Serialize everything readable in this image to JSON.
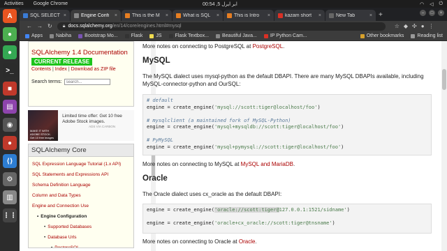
{
  "system": {
    "activities": "Activities",
    "app": "Google Chrome",
    "clock": "00:54 ,5 ابر ایرل",
    "tray": [
      "wifi-icon",
      "volume-icon",
      "power-icon"
    ]
  },
  "dock": {
    "apps": [
      {
        "name": "ubuntu-software-icon",
        "color": "#e95420",
        "glyph": "A"
      },
      {
        "name": "chrome-icon",
        "color": "#4caf50",
        "glyph": "●"
      },
      {
        "name": "chrome-alt-icon",
        "color": "#34a853",
        "glyph": "●"
      },
      {
        "name": "terminal-icon",
        "color": "#2b2b2b",
        "glyph": ">_"
      },
      {
        "name": "screen-recorder-icon",
        "color": "#c0392b",
        "glyph": "■"
      },
      {
        "name": "files-icon",
        "color": "#8e44ad",
        "glyph": "▤"
      },
      {
        "name": "camera-icon",
        "color": "#555",
        "glyph": "◉"
      },
      {
        "name": "recorder-icon",
        "color": "#c0392b",
        "glyph": "●"
      },
      {
        "name": "vscode-icon",
        "color": "#2d7dd2",
        "glyph": "⟨⟩"
      },
      {
        "name": "settings-icon",
        "color": "#666",
        "glyph": "⚙"
      },
      {
        "name": "trash-icon",
        "color": "#888",
        "glyph": "▥"
      },
      {
        "name": "apps-grid-icon",
        "color": "#444",
        "glyph": "⋮⋮"
      }
    ]
  },
  "tabs": [
    {
      "title": "SQL SELECT",
      "color": "#3a7bd5",
      "active": false
    },
    {
      "title": "Engine Confi",
      "color": "#888",
      "active": true
    },
    {
      "title": "This is the M",
      "color": "#e67e22",
      "active": false
    },
    {
      "title": "What is SQL",
      "color": "#e67e22",
      "active": false
    },
    {
      "title": "This is Intro",
      "color": "#e67e22",
      "active": false
    },
    {
      "title": "kazam short",
      "color": "#d93025",
      "active": false
    },
    {
      "title": "New Tab",
      "color": "#666",
      "active": false
    }
  ],
  "address": {
    "host": "docs.sqlalchemy.org",
    "path": "/en/14/core/engines.html#mysql"
  },
  "bookmarks": {
    "items": [
      {
        "label": "Apps",
        "color": "#4285f4"
      },
      {
        "label": "Nabiha",
        "color": "#888"
      },
      {
        "label": "Bootstrap Mo...",
        "color": "#7952b3"
      },
      {
        "label": "Flask",
        "color": "#333"
      },
      {
        "label": "JS",
        "color": "#f0db4f"
      },
      {
        "label": "Flask Textbox...",
        "color": "#333"
      },
      {
        "label": "Beautiful Java...",
        "color": "#888"
      },
      {
        "label": "IP Python Cam...",
        "color": "#d93025"
      }
    ],
    "other": "Other bookmarks",
    "reading": "Reading list"
  },
  "sidebar": {
    "title": "SQLAlchemy 1.4 Documentation",
    "release": "CURRENT RELEASE",
    "links": [
      "Contents",
      "Index",
      "Download as ZIP file"
    ],
    "search_label": "Search terms:",
    "search_placeholder": "search...",
    "ad_text": "Limited time offer: Get 10 free Adobe Stock images.",
    "ad_img_text": "MAKE IT WITH ADOBE STOCK.",
    "ad_img_cta": "Get 10 free images",
    "ad_small": "ADS VIA CARBON",
    "toc_title": "SQLAlchemy Core",
    "toc": [
      {
        "label": "SQL Expression Language Tutorial (1.x API)",
        "level": 1
      },
      {
        "label": "SQL Statements and Expressions API",
        "level": 1
      },
      {
        "label": "Schema Definition Language",
        "level": 1
      },
      {
        "label": "Column and Data Types",
        "level": 1
      },
      {
        "label": "Engine and Connection Use",
        "level": 1
      },
      {
        "label": "Engine Configuration",
        "level": 2
      },
      {
        "label": "Supported Databases",
        "level": 3
      },
      {
        "label": "Database Urls",
        "level": 3
      },
      {
        "label": "PostgreSQL",
        "level": 4
      }
    ]
  },
  "main": {
    "pg_note_prefix": "More notes on connecting to PostgreSQL at ",
    "pg_note_link": "PostgreSQL",
    "mysql_heading": "MySQL",
    "mysql_para": "The MySQL dialect uses mysql-python as the default DBAPI. There are many MySQL DBAPIs available, including MySQL-connector-python and OurSQL:",
    "mysql_code": [
      {
        "type": "cmt",
        "text": "# default"
      },
      {
        "type": "code",
        "pre": "engine = create_engine(",
        "str": "'mysql://scott:tiger@localhost/foo'",
        "post": ")"
      },
      {
        "type": "blank",
        "text": ""
      },
      {
        "type": "cmt",
        "text": "# mysqlclient (a maintained fork of MySQL-Python)"
      },
      {
        "type": "code",
        "pre": "engine = create_engine(",
        "str": "'mysql+mysqldb://scott:tiger@localhost/foo'",
        "post": ")"
      },
      {
        "type": "blank",
        "text": ""
      },
      {
        "type": "cmt",
        "text": "# PyMySQL"
      },
      {
        "type": "code",
        "pre": "engine = create_engine(",
        "str": "'mysql+pymysql://scott:tiger@localhost/foo'",
        "post": ")"
      }
    ],
    "mysql_note_prefix": "More notes on connecting to MySQL at ",
    "mysql_note_link": "MySQL and MariaDB",
    "oracle_heading": "Oracle",
    "oracle_para": "The Oracle dialect uses cx_oracle as the default DBAPI:",
    "oracle_code_1_pre": "engine = create_engine(",
    "oracle_code_1_str_a": "'oracle://scott:tiger@",
    "oracle_code_1_str_b": "127.0.0.1:1521/sidname'",
    "oracle_code_1_post": ")",
    "oracle_code_2_pre": "engine = create_engine(",
    "oracle_code_2_str": "'oracle+cx_oracle://scott:tiger@tnsname'",
    "oracle_code_2_post": ")",
    "oracle_note_prefix": "More notes on connecting to Oracle at ",
    "oracle_note_link": "Oracle"
  }
}
